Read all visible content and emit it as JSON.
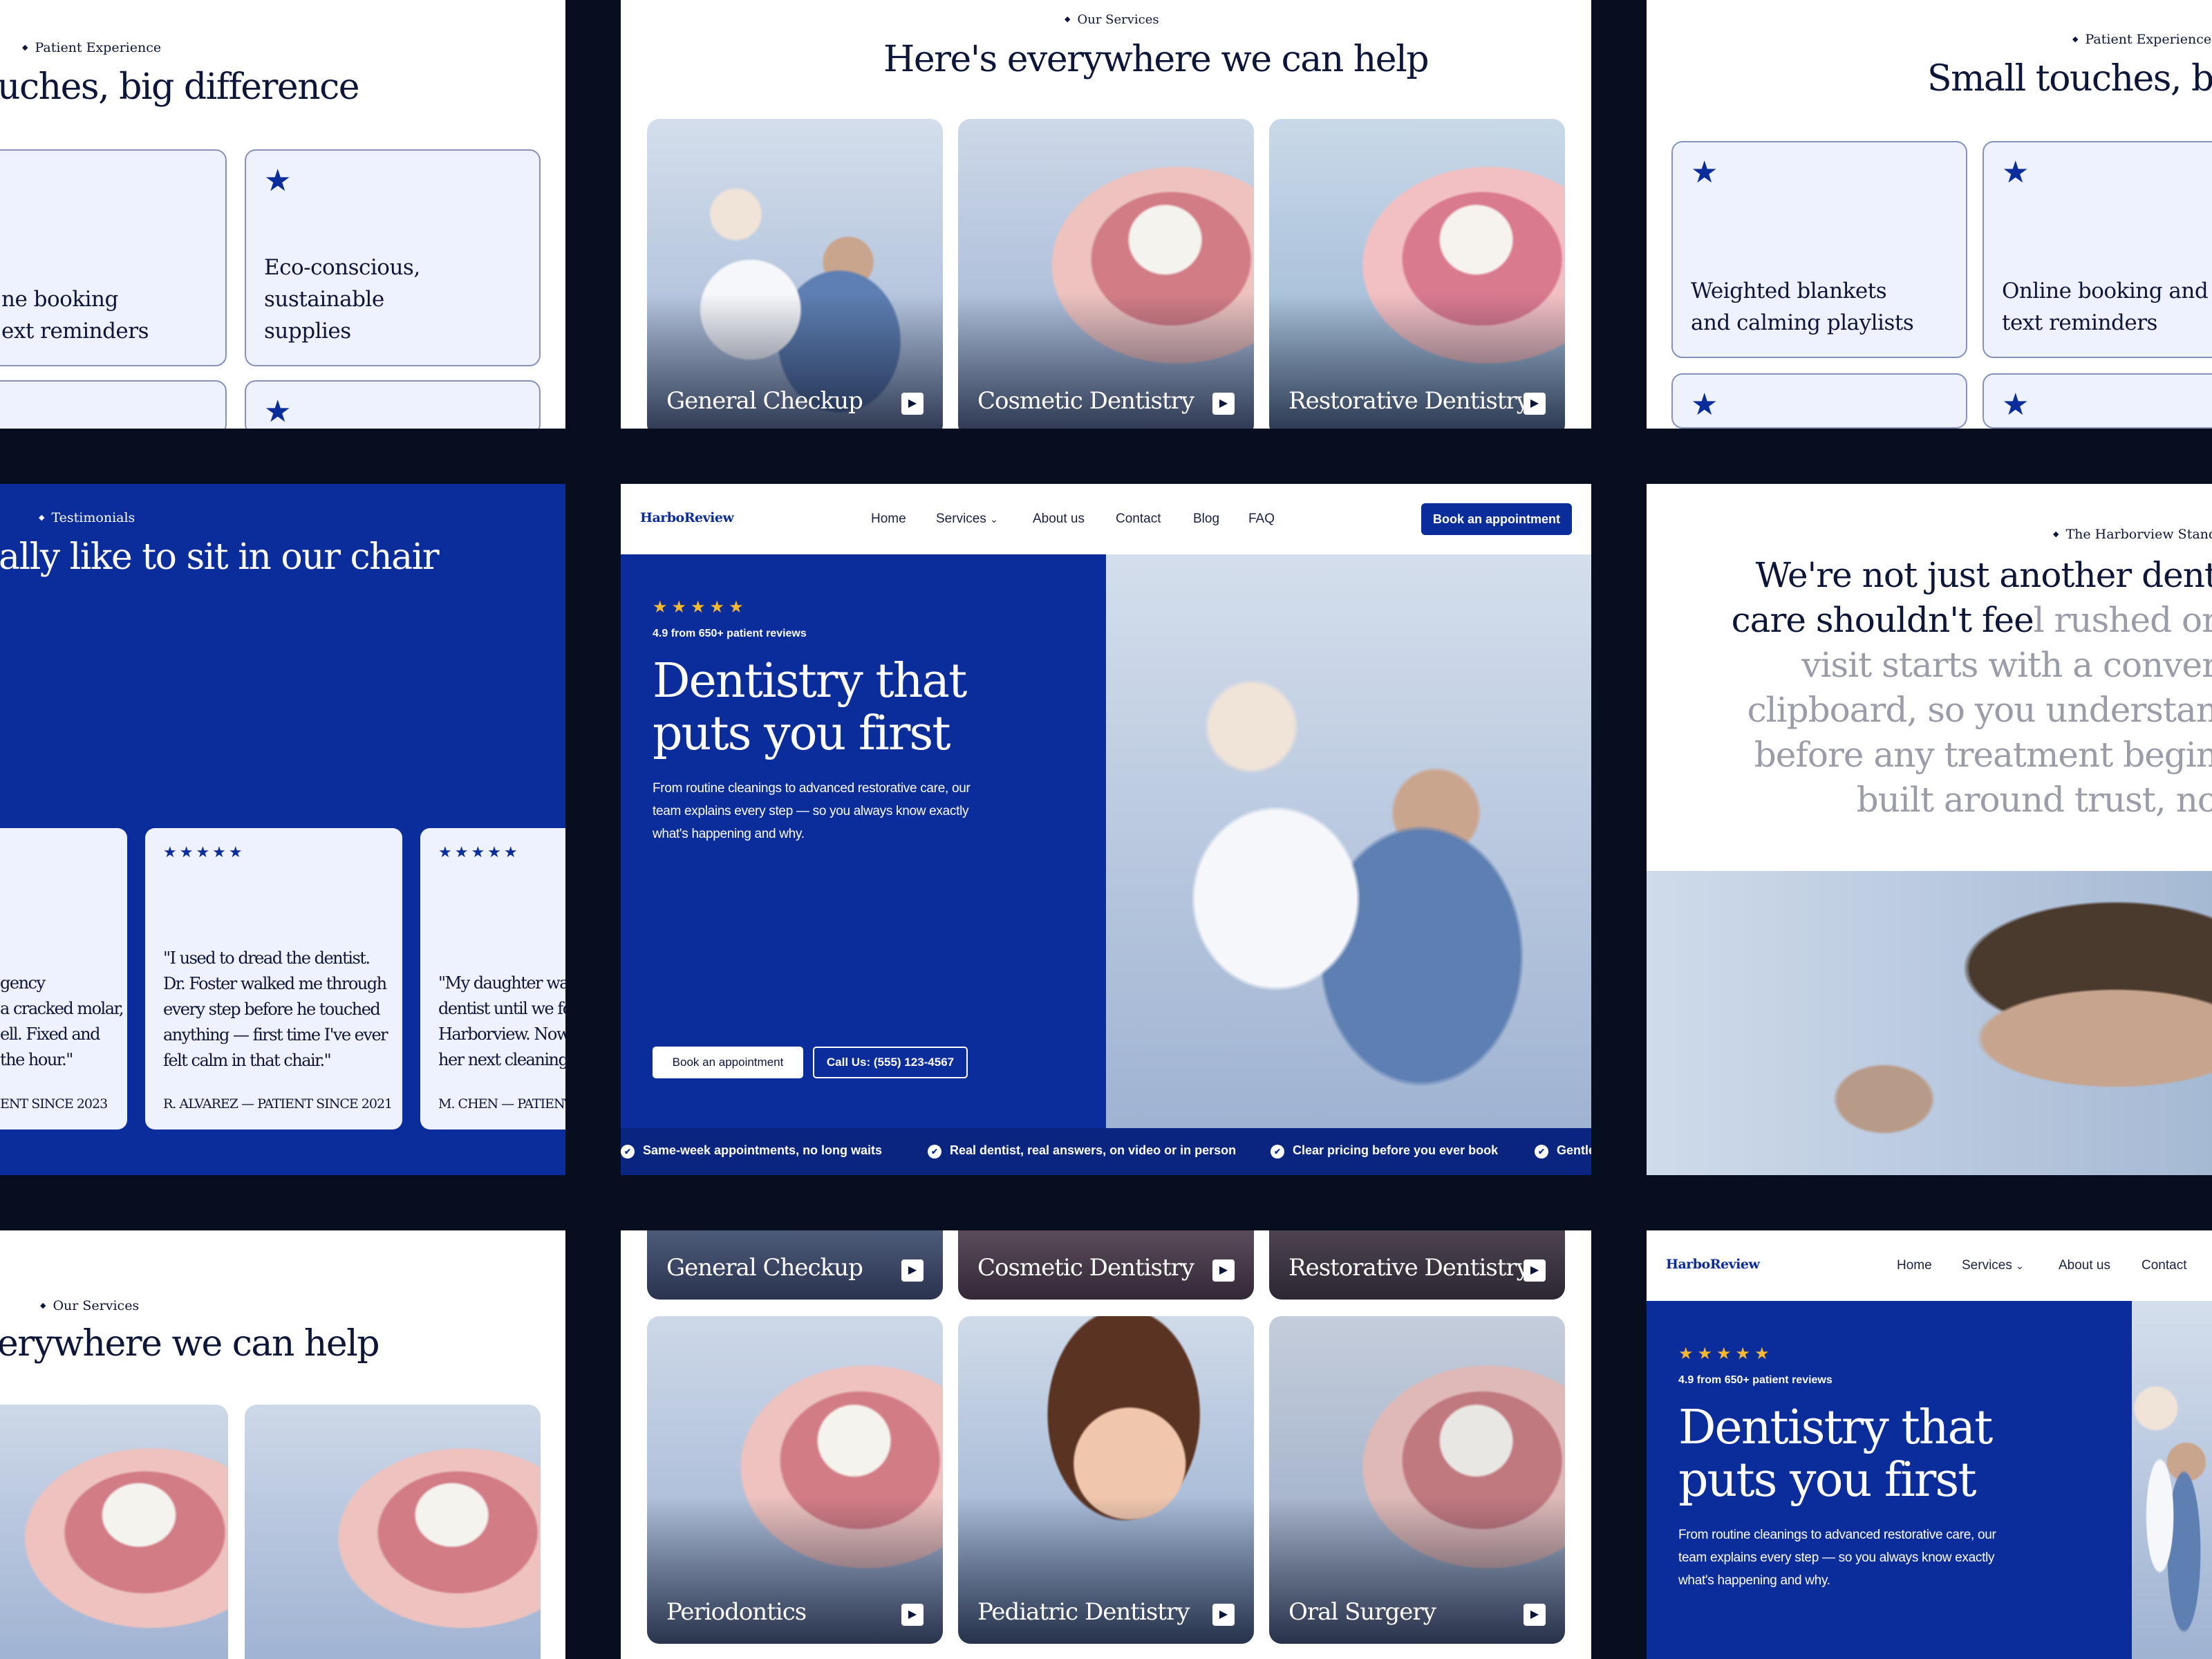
{
  "site": {
    "logo": "HarboReview"
  },
  "nav": {
    "home": "Home",
    "services": "Services",
    "about": "About us",
    "contact": "Contact",
    "blog": "Blog",
    "faq": "FAQ",
    "cta": "Book an appointment"
  },
  "hero": {
    "stars": "★★★★★",
    "rating": "4.9 from 650+ patient reviews",
    "title": "Dentistry that puts you first",
    "subtitle": "From routine cleanings to advanced restorative care, our team explains every step — so you always know exactly what's happening and why.",
    "book": "Book an appointment",
    "call": "Call Us: (555) 123-4567"
  },
  "ticker": [
    "Same-week appointments, no long waits",
    "Real dentist, real answers, on video or in person",
    "Clear pricing before you ever book",
    "Gentle"
  ],
  "experience": {
    "eyebrow": "Patient Experience",
    "title": "Small touches, big difference",
    "title_left_crop": "uches, big difference",
    "title_right_crop": "Small touches, big d",
    "items": [
      "Weighted blankets and calming playlists",
      "Online booking and text reminders",
      "Eco-conscious, sustainable supplies"
    ],
    "left_crop_item": "ne booking\next reminders"
  },
  "services": {
    "eyebrow": "Our Services",
    "title": "Here's everywhere we can help",
    "title_crop": "erywhere we can help",
    "items": [
      "General Checkup",
      "Cosmetic Dentistry",
      "Restorative Dentistry",
      "Periodontics",
      "Pediatric Dentistry",
      "Oral Surgery"
    ]
  },
  "testimonials": {
    "eyebrow": "Testimonials",
    "title_crop": "ally like to sit in our chair",
    "stars": "★★★★★",
    "cards": [
      {
        "quote": "gency\na cracked molar,\nell. Fixed and\nthe hour.\"",
        "author": "ENT SINCE 2023"
      },
      {
        "quote": "\"I used to dread the dentist. Dr. Foster walked me through every step before he touched anything — first time I've ever felt calm in that chair.\"",
        "author": "R. ALVAREZ — PATIENT SINCE 2021"
      },
      {
        "quote": "\"My daughter was\ndentist until we fou\nHarborview. Now s\nher next cleaning is",
        "author": "M. CHEN — PATIENT S"
      }
    ]
  },
  "standard": {
    "eyebrow": "The Harborview Standard",
    "lines": [
      "We're not just another dent",
      "care shouldn't feel rushed or",
      "visit starts with a conver",
      "clipboard, so you understan",
      "before any treatment begin",
      "built around trust, no"
    ],
    "line2_dark": "care shouldn't fee",
    "line2_light": "l rushed or"
  }
}
